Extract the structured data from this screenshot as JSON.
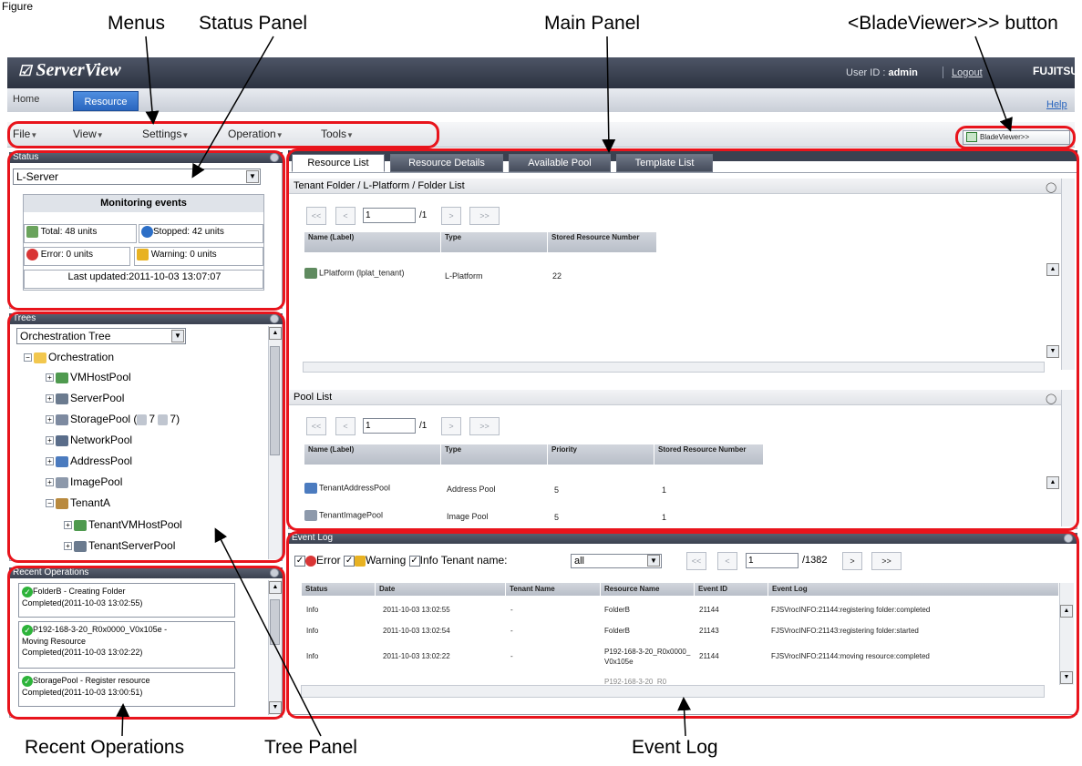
{
  "figure_label": "Figure",
  "callouts": {
    "menus": "Menus",
    "status_panel": "Status Panel",
    "main_panel": "Main Panel",
    "bladeviewer_button": "<BladeViewer>>> button",
    "recent_operations": "Recent Operations",
    "tree_panel": "Tree Panel",
    "event_log": "Event Log"
  },
  "header": {
    "logo": "ServerView",
    "user_id_label": "User ID : ",
    "user_id_value": "admin",
    "logout": "Logout",
    "brand": "FUJITSU"
  },
  "tabs": {
    "home": "Home",
    "resource": "Resource",
    "help": "Help"
  },
  "menus": [
    "File",
    "View",
    "Settings",
    "Operation",
    "Tools"
  ],
  "bladeviewer_label": "BladeViewer>>",
  "status": {
    "title": "Status",
    "select_value": "L-Server",
    "monitoring_title": "Monitoring events",
    "total": "Total: 48 units",
    "stopped": "Stopped: 42 units",
    "error": "Error: 0 units",
    "warning": "Warning: 0 units",
    "last_updated": "Last updated:2011-10-03 13:07:07"
  },
  "trees": {
    "title": "Trees",
    "select_value": "Orchestration Tree",
    "root": "Orchestration",
    "items": [
      "VMHostPool",
      "ServerPool",
      "StoragePool (",
      "7",
      "7)",
      "NetworkPool",
      "AddressPool",
      "ImagePool",
      "TenantA",
      "TenantVMHostPool",
      "TenantServerPool"
    ]
  },
  "recent": {
    "title": "Recent Operations",
    "items": [
      {
        "line1": "FolderB - Creating Folder",
        "line2": "Completed(2011-10-03 13:02:55)"
      },
      {
        "line1": "P192-168-3-20_R0x0000_V0x105e -",
        "line2": "Moving Resource",
        "line3": "Completed(2011-10-03 13:02:22)"
      },
      {
        "line1": "StoragePool - Register resource",
        "line2": "Completed(2011-10-03 13:00:51)"
      }
    ]
  },
  "main_tabs": [
    "Resource List",
    "Resource Details",
    "Available Pool",
    "Template List"
  ],
  "tenant_section": {
    "title": "Tenant Folder / L-Platform / Folder List",
    "pager": {
      "first": "<<",
      "prev": "<",
      "page": "1",
      "total": "/1",
      "next": ">",
      "last": ">>"
    },
    "columns": [
      "Name (Label)",
      "Type",
      "Stored Resource Number"
    ],
    "rows": [
      [
        "LPlatform (lplat_tenant)",
        "L-Platform",
        "22"
      ]
    ]
  },
  "pool_section": {
    "title": "Pool List",
    "pager": {
      "first": "<<",
      "prev": "<",
      "page": "1",
      "total": "/1",
      "next": ">",
      "last": ">>"
    },
    "columns": [
      "Name (Label)",
      "Type",
      "Priority",
      "Stored Resource Number"
    ],
    "rows": [
      [
        "TenantAddressPool",
        "Address Pool",
        "5",
        "1"
      ],
      [
        "TenantImagePool",
        "Image Pool",
        "5",
        "1"
      ]
    ]
  },
  "event_log": {
    "title": "Event Log",
    "filter_error": "Error",
    "filter_warning": "Warning",
    "filter_info": "Info",
    "tenant_label": "Tenant name:",
    "tenant_value": "all",
    "pager": {
      "first": "<<",
      "prev": "<",
      "page": "1",
      "total": "/1382",
      "next": ">",
      "last": ">>"
    },
    "columns": [
      "Status",
      "Date",
      "Tenant Name",
      "Resource Name",
      "Event ID",
      "Event Log"
    ],
    "rows": [
      [
        "Info",
        "2011-10-03 13:02:55",
        "-",
        "FolderB",
        "21144",
        "FJSVrocINFO:21144:registering folder:completed"
      ],
      [
        "Info",
        "2011-10-03 13:02:54",
        "-",
        "FolderB",
        "21143",
        "FJSVrocINFO:21143:registering folder:started"
      ],
      [
        "Info",
        "2011-10-03 13:02:22",
        "-",
        "P192-168-3-20_R0x0000_V0x105e",
        "21144",
        "FJSVrocINFO:21144:moving resource:completed"
      ],
      [
        "",
        "",
        "",
        "P192-168-3-20_R0",
        "",
        ""
      ]
    ]
  },
  "colors": {
    "accent_red": "#e8141c",
    "header_dark": "#3a4150",
    "tab_blue": "#2a66bf",
    "ok_green": "#2db33a"
  }
}
